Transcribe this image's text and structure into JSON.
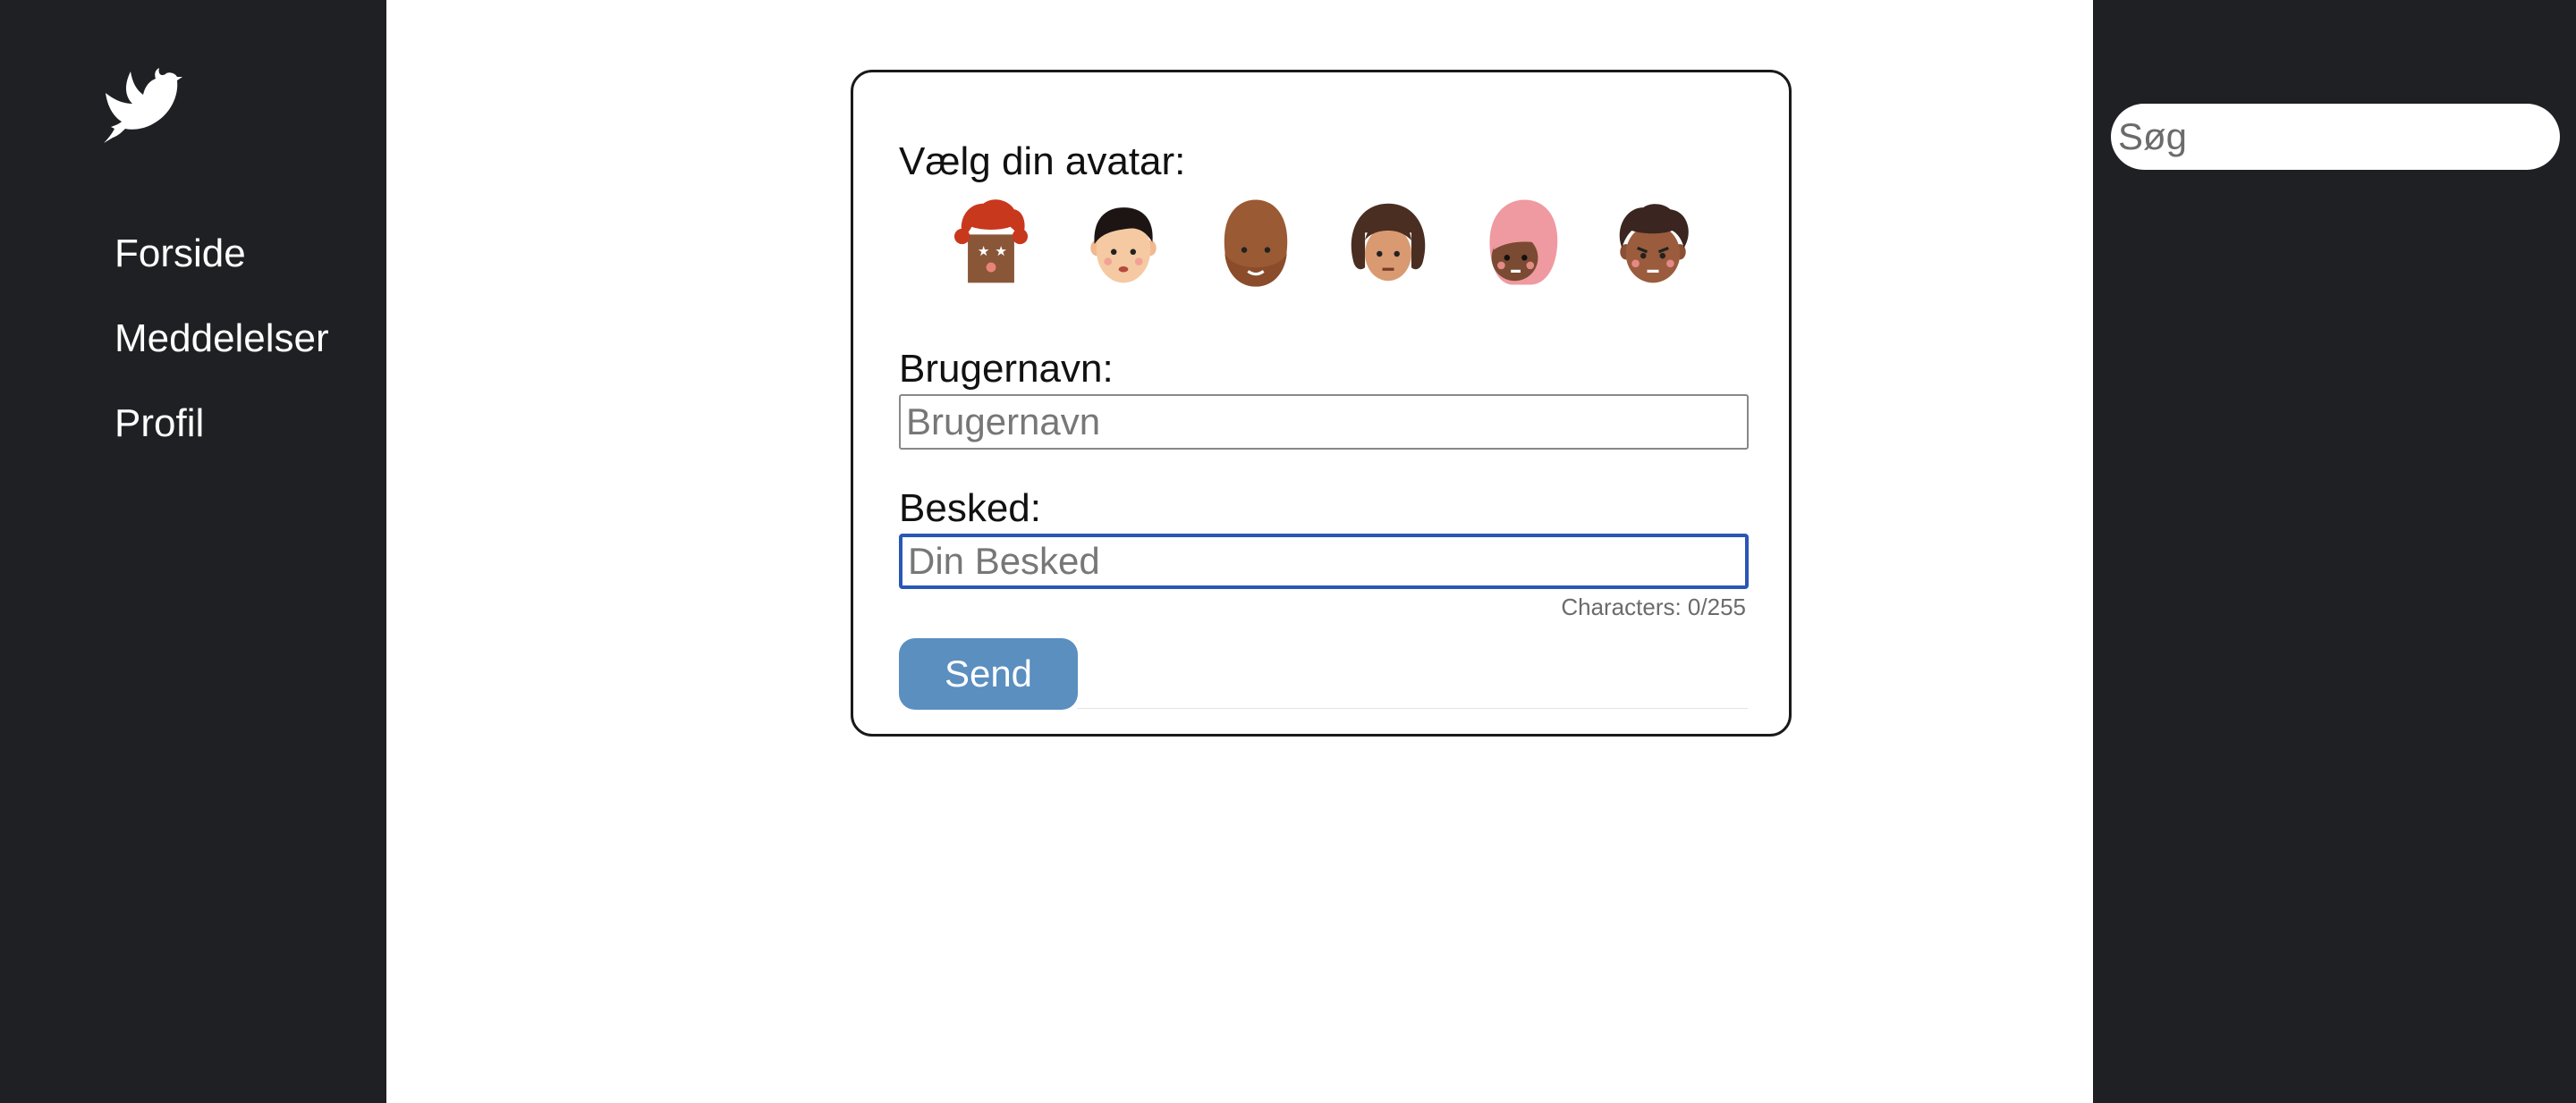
{
  "nav": {
    "items": [
      {
        "label": "Forside"
      },
      {
        "label": "Meddelelser"
      },
      {
        "label": "Profil"
      }
    ]
  },
  "search": {
    "placeholder": "Søg"
  },
  "form": {
    "avatar_label": "Vælg din avatar:",
    "avatars": [
      "red-curly-hair-avatar",
      "short-black-hair-avatar",
      "brown-bald-bearded-avatar",
      "brown-wavy-hair-avatar",
      "pink-hair-avatar",
      "dark-curly-hair-avatar"
    ],
    "username_label": "Brugernavn:",
    "username_placeholder": "Brugernavn",
    "username_value": "",
    "message_label": "Besked:",
    "message_placeholder": "Din Besked",
    "message_value": "",
    "char_count": "Characters: 0/255",
    "send_label": "Send"
  },
  "colors": {
    "sidebar_bg": "#1f2023",
    "send_button": "#5a8fc0",
    "focus_border": "#2a56b4"
  }
}
